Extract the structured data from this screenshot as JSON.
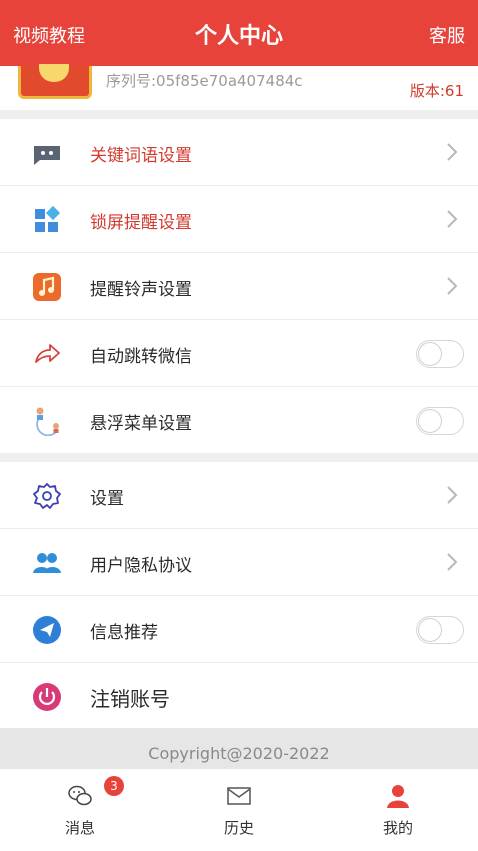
{
  "header": {
    "left": "视频教程",
    "title": "个人中心",
    "right": "客服"
  },
  "profile": {
    "serial": "序列号:05f85e70a407484c",
    "version": "版本:61"
  },
  "group1": [
    {
      "label": "关键词语设置",
      "accent": true,
      "icon": "chat-bubble-icon",
      "control": "chevron"
    },
    {
      "label": "锁屏提醒设置",
      "accent": true,
      "icon": "grid-apps-icon",
      "control": "chevron"
    },
    {
      "label": "提醒铃声设置",
      "accent": false,
      "icon": "music-note-icon",
      "control": "chevron"
    },
    {
      "label": "自动跳转微信",
      "accent": false,
      "icon": "share-arrow-icon",
      "control": "toggle",
      "on": false
    },
    {
      "label": "悬浮菜单设置",
      "accent": false,
      "icon": "floating-people-icon",
      "control": "toggle",
      "on": false
    }
  ],
  "group2": [
    {
      "label": "设置",
      "icon": "gear-icon",
      "control": "chevron"
    },
    {
      "label": "用户隐私协议",
      "icon": "users-icon",
      "control": "chevron"
    },
    {
      "label": "信息推荐",
      "icon": "paper-plane-icon",
      "control": "toggle",
      "on": false
    },
    {
      "label": "注销账号",
      "icon": "power-icon",
      "control": "none"
    }
  ],
  "copyright": "Copyright@2020-2022",
  "tabs": [
    {
      "label": "消息",
      "badge": "3",
      "icon": "wechat-icon"
    },
    {
      "label": "历史",
      "icon": "mail-icon"
    },
    {
      "label": "我的",
      "icon": "person-icon",
      "active": true
    }
  ],
  "colors": {
    "brand": "#e7433b",
    "accent_text": "#d33a2f"
  }
}
